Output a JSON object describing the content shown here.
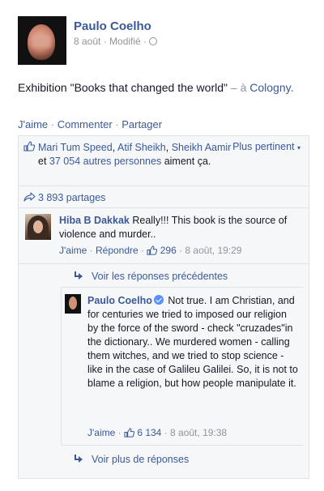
{
  "post": {
    "author": "Paulo Coelho",
    "date": "8 août",
    "edited": "Modifié",
    "text": "Exhibition \"Books that changed the world\"",
    "location_sep": "– à",
    "location": "Cologny."
  },
  "actions": {
    "like": "J'aime",
    "comment": "Commenter",
    "share": "Partager"
  },
  "likes": {
    "names": [
      "Mari Tum Speed",
      "Atif Sheikh",
      "Sheikh Aamir"
    ],
    "and_text": "et",
    "others": "37 054 autres personnes",
    "suffix": "aiment ça.",
    "sort_label": "Plus pertinent"
  },
  "shares": {
    "label": "3 893 partages"
  },
  "comment1": {
    "author": "Hiba B Dakkak",
    "text": "Really!!! This book is the source of violence and murder..",
    "like": "J'aime",
    "reply": "Répondre",
    "like_count": "296",
    "date": "8 août, 19:29"
  },
  "previous_replies": "Voir les réponses précédentes",
  "reply1": {
    "author": "Paulo Coelho",
    "text": "Not true. I am Christian, and for centuries we tried to imposed our religion by the force of the sword - check \"cruzades\"in the dictionary.. We murdered women - calling them witches, and we tried to stop science - like in the case of Galileu Galilei. So, it is not to blame a religion, but how people manipulate it.",
    "like": "J'aime",
    "like_count": "6 134",
    "date": "8 août, 19:38"
  },
  "more_replies": "Voir plus de réponses",
  "colors": {
    "link": "#3b5998",
    "meta": "#90949c",
    "box_bg": "#f6f7f9",
    "border": "#e1e2e6"
  }
}
